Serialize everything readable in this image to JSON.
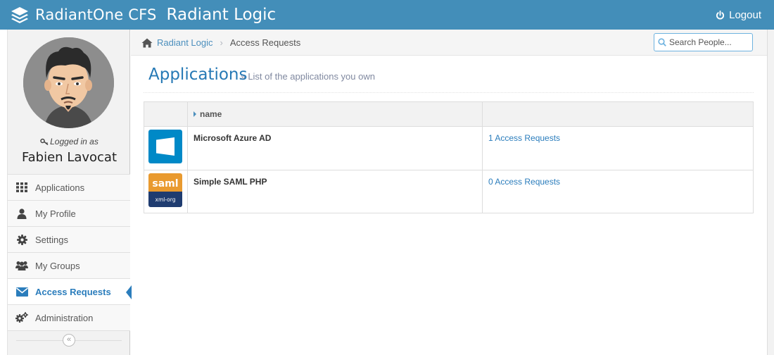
{
  "header": {
    "product": "RadiantOne CFS",
    "company": "Radiant Logic",
    "logout_label": "Logout",
    "bg_color": "#438eb9"
  },
  "user": {
    "logged_in_label": "Logged in as",
    "name": "Fabien Lavocat"
  },
  "sidebar": {
    "items": [
      {
        "label": "Applications",
        "icon": "grid-icon"
      },
      {
        "label": "My Profile",
        "icon": "user-icon"
      },
      {
        "label": "Settings",
        "icon": "gear-icon"
      },
      {
        "label": "My Groups",
        "icon": "users-icon"
      },
      {
        "label": "Access Requests",
        "icon": "envelope-icon",
        "active": true
      },
      {
        "label": "Administration",
        "icon": "cogs-icon"
      }
    ],
    "active_color": "#2b7dbc"
  },
  "breadcrumb": {
    "home": "Radiant Logic",
    "current": "Access Requests"
  },
  "search": {
    "placeholder": "Search People..."
  },
  "page": {
    "title": "Applications",
    "subtitle": "List of the applications you own"
  },
  "table": {
    "columns": [
      "",
      "name",
      ""
    ],
    "rows": [
      {
        "name": "Microsoft Azure AD",
        "requests": "1 Access Requests",
        "logo": "windows-logo"
      },
      {
        "name": "Simple SAML PHP",
        "requests": "0 Access Requests",
        "logo": "saml-logo",
        "logo_text": "saml",
        "logo_subtext": "xml-org"
      }
    ]
  }
}
